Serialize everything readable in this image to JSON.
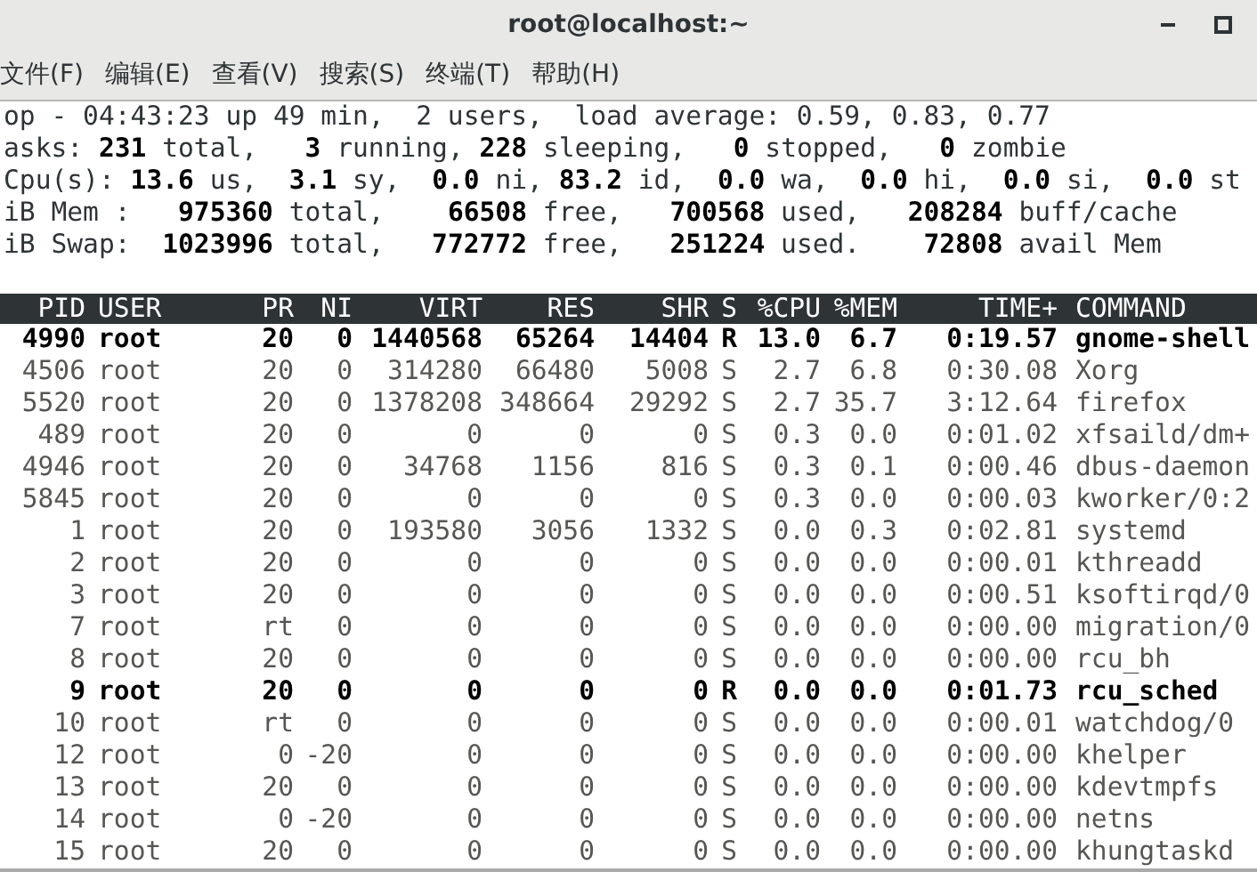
{
  "window": {
    "title": "root@localhost:~"
  },
  "menu": [
    "文件(F)",
    "编辑(E)",
    "查看(V)",
    "搜索(S)",
    "终端(T)",
    "帮助(H)"
  ],
  "summary": [
    "op - 04:43:23 up 49 min,  2 users,  load average: 0.59, 0.83, 0.77",
    "asks: **231** total,   **3** running, **228** sleeping,   **0** stopped,   **0** zombie",
    "Cpu(s): **13.6** us,  **3.1** sy,  **0.0** ni, **83.2** id,  **0.0** wa,  **0.0** hi,  **0.0** si,  **0.0** st",
    "iB Mem :   **975360** total,    **66508** free,   **700568** used,   **208284** buff/cache",
    "iB Swap:  **1023996** total,   **772772** free,   **251224** used.    **72808** avail Mem"
  ],
  "table": {
    "columns": [
      "PID",
      "USER",
      "PR",
      "NI",
      "VIRT",
      "RES",
      "SHR",
      "S",
      "%CPU",
      "%MEM",
      "TIME+",
      "COMMAND"
    ],
    "rows": [
      {
        "bold": true,
        "cells": [
          "4990",
          "root",
          "20",
          "0",
          "1440568",
          "65264",
          "14404",
          "R",
          "13.0",
          "6.7",
          "0:19.57",
          "gnome-shell"
        ]
      },
      {
        "bold": false,
        "cells": [
          "4506",
          "root",
          "20",
          "0",
          "314280",
          "66480",
          "5008",
          "S",
          "2.7",
          "6.8",
          "0:30.08",
          "Xorg"
        ]
      },
      {
        "bold": false,
        "cells": [
          "5520",
          "root",
          "20",
          "0",
          "1378208",
          "348664",
          "29292",
          "S",
          "2.7",
          "35.7",
          "3:12.64",
          "firefox"
        ]
      },
      {
        "bold": false,
        "cells": [
          "489",
          "root",
          "20",
          "0",
          "0",
          "0",
          "0",
          "S",
          "0.3",
          "0.0",
          "0:01.02",
          "xfsaild/dm+"
        ]
      },
      {
        "bold": false,
        "cells": [
          "4946",
          "root",
          "20",
          "0",
          "34768",
          "1156",
          "816",
          "S",
          "0.3",
          "0.1",
          "0:00.46",
          "dbus-daemon"
        ]
      },
      {
        "bold": false,
        "cells": [
          "5845",
          "root",
          "20",
          "0",
          "0",
          "0",
          "0",
          "S",
          "0.3",
          "0.0",
          "0:00.03",
          "kworker/0:2"
        ]
      },
      {
        "bold": false,
        "cells": [
          "1",
          "root",
          "20",
          "0",
          "193580",
          "3056",
          "1332",
          "S",
          "0.0",
          "0.3",
          "0:02.81",
          "systemd"
        ]
      },
      {
        "bold": false,
        "cells": [
          "2",
          "root",
          "20",
          "0",
          "0",
          "0",
          "0",
          "S",
          "0.0",
          "0.0",
          "0:00.01",
          "kthreadd"
        ]
      },
      {
        "bold": false,
        "cells": [
          "3",
          "root",
          "20",
          "0",
          "0",
          "0",
          "0",
          "S",
          "0.0",
          "0.0",
          "0:00.51",
          "ksoftirqd/0"
        ]
      },
      {
        "bold": false,
        "cells": [
          "7",
          "root",
          "rt",
          "0",
          "0",
          "0",
          "0",
          "S",
          "0.0",
          "0.0",
          "0:00.00",
          "migration/0"
        ]
      },
      {
        "bold": false,
        "cells": [
          "8",
          "root",
          "20",
          "0",
          "0",
          "0",
          "0",
          "S",
          "0.0",
          "0.0",
          "0:00.00",
          "rcu_bh"
        ]
      },
      {
        "bold": true,
        "cells": [
          "9",
          "root",
          "20",
          "0",
          "0",
          "0",
          "0",
          "R",
          "0.0",
          "0.0",
          "0:01.73",
          "rcu_sched"
        ]
      },
      {
        "bold": false,
        "cells": [
          "10",
          "root",
          "rt",
          "0",
          "0",
          "0",
          "0",
          "S",
          "0.0",
          "0.0",
          "0:00.01",
          "watchdog/0"
        ]
      },
      {
        "bold": false,
        "cells": [
          "12",
          "root",
          "0",
          "-20",
          "0",
          "0",
          "0",
          "S",
          "0.0",
          "0.0",
          "0:00.00",
          "khelper"
        ]
      },
      {
        "bold": false,
        "cells": [
          "13",
          "root",
          "20",
          "0",
          "0",
          "0",
          "0",
          "S",
          "0.0",
          "0.0",
          "0:00.00",
          "kdevtmpfs"
        ]
      },
      {
        "bold": false,
        "cells": [
          "14",
          "root",
          "0",
          "-20",
          "0",
          "0",
          "0",
          "S",
          "0.0",
          "0.0",
          "0:00.00",
          "netns"
        ]
      },
      {
        "bold": false,
        "cells": [
          "15",
          "root",
          "20",
          "0",
          "0",
          "0",
          "0",
          "S",
          "0.0",
          "0.0",
          "0:00.00",
          "khungtaskd"
        ]
      }
    ]
  }
}
